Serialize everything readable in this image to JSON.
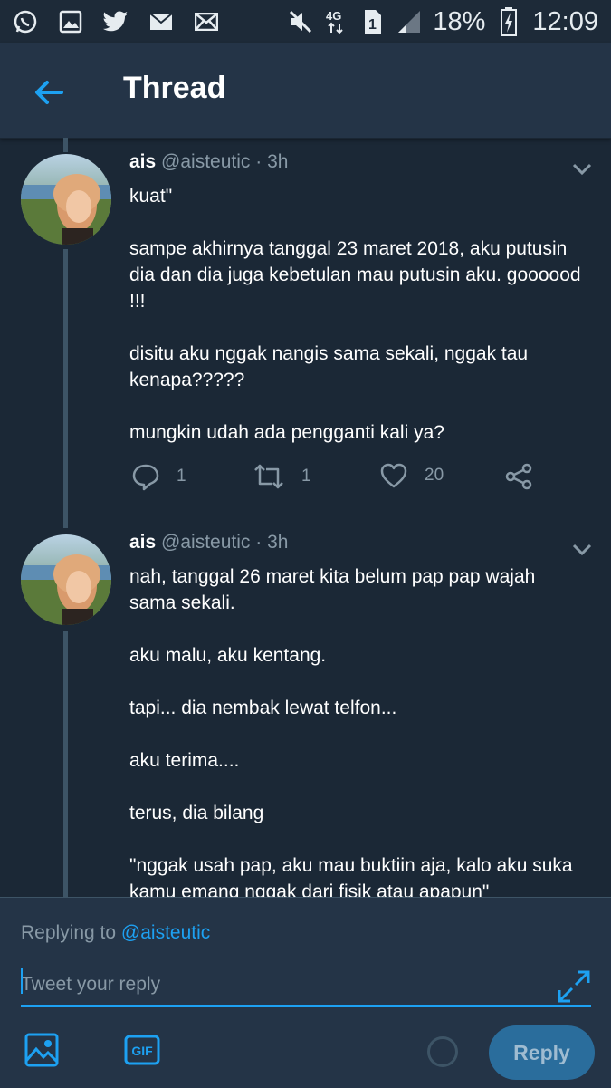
{
  "status_bar": {
    "icons_left": [
      "whatsapp-icon",
      "gallery-icon",
      "twitter-icon",
      "email-icon",
      "mail-icon"
    ],
    "icons_right": [
      "mute-icon",
      "network-4g-icon",
      "sim-1-icon",
      "signal-icon"
    ],
    "battery": "18%",
    "time": "12:09"
  },
  "app_bar": {
    "title": "Thread"
  },
  "tweets": [
    {
      "name": "ais",
      "handle": "@aisteutic",
      "time": "· 3h",
      "paragraphs": [
        "kuat\"",
        "sampe akhirnya tanggal 23 maret 2018, aku putusin dia dan dia juga kebetulan mau putusin aku. goooood !!!",
        "disitu aku nggak nangis sama sekali, nggak tau kenapa?????",
        "mungkin udah ada pengganti kali ya?"
      ],
      "replies": "1",
      "retweets": "1",
      "likes": "20"
    },
    {
      "name": "ais",
      "handle": "@aisteutic",
      "time": "· 3h",
      "paragraphs": [
        "nah, tanggal 26 maret kita belum pap pap wajah sama sekali.",
        "aku malu, aku kentang.",
        "tapi... dia nembak lewat telfon...",
        "aku terima....",
        "terus, dia bilang",
        "\"nggak usah pap, aku mau buktiin aja, kalo aku suka kamu emang nggak dari fisik atau apapun\""
      ]
    }
  ],
  "composer": {
    "replying_prefix": "Replying to",
    "replying_handle": "@aisteutic",
    "placeholder": "Tweet your reply",
    "gif_label": "GIF",
    "reply_button": "Reply"
  },
  "colors": {
    "background": "#1b2836",
    "bar": "#243447",
    "accent": "#1da1f2",
    "secondary_text": "#8899a6"
  }
}
